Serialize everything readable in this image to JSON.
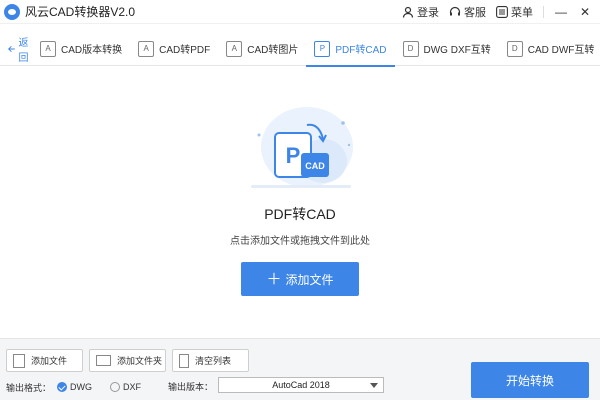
{
  "app": {
    "title": "风云CAD转换器V2.0"
  },
  "titlebar": {
    "login": "登录",
    "support": "客服",
    "menu": "菜单",
    "minimize": "—",
    "close": "✕"
  },
  "nav": {
    "back": "返回",
    "tabs": [
      {
        "label": "CAD版本转换",
        "icon": "version-convert-icon",
        "active": false
      },
      {
        "label": "CAD转PDF",
        "icon": "cad-to-pdf-icon",
        "active": false
      },
      {
        "label": "CAD转图片",
        "icon": "cad-to-image-icon",
        "active": false
      },
      {
        "label": "PDF转CAD",
        "icon": "pdf-to-cad-icon",
        "active": true
      },
      {
        "label": "DWG DXF互转",
        "icon": "dwg-dxf-icon",
        "active": false
      },
      {
        "label": "CAD DWF互转",
        "icon": "cad-dwf-icon",
        "active": false
      }
    ]
  },
  "main": {
    "title": "PDF转CAD",
    "hint": "点击添加文件或拖拽文件到此处",
    "add_button": "添加文件",
    "illustration": {
      "p_letter": "P",
      "cad_label": "CAD"
    }
  },
  "bottom": {
    "add_file": "添加文件",
    "add_folder": "添加文件夹",
    "clear_list": "清空列表",
    "format_label": "输出格式：",
    "formats": [
      {
        "label": "DWG",
        "selected": true
      },
      {
        "label": "DXF",
        "selected": false
      }
    ],
    "version_label": "输出版本：",
    "version_value": "AutoCad 2018",
    "start_button": "开始转换"
  },
  "colors": {
    "accent": "#3d86e8",
    "bottom_bg": "#f4f5f7"
  }
}
